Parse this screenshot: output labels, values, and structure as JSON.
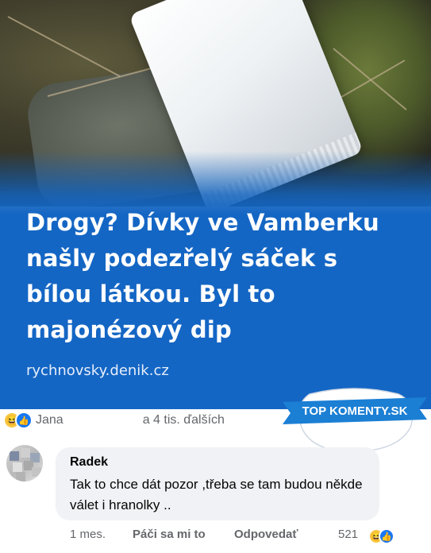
{
  "article": {
    "headline": "Drogy? Dívky ve Vamberku našly podezřelý sáček s bílou látkou. Byl to majonézový dip",
    "source": "rychnovsky.denik.cz"
  },
  "reactions": {
    "icons": [
      "haha-emoji-icon",
      "like-icon"
    ],
    "first_name": "Jana",
    "others": "a 4 tis. ďalších"
  },
  "badge": {
    "text": "TOP KOMENTY.SK",
    "color": "#1b7fd4"
  },
  "comment": {
    "author": "Radek",
    "text": "Tak to chce dát pozor ,třeba se tam budou někde válet i hranolky ..",
    "time": "1 mes.",
    "like_label": "Páči sa mi to",
    "reply_label": "Odpovedať",
    "reaction_count": "521"
  },
  "colors": {
    "headline_band": "#1466c4",
    "like_blue": "#1877f2",
    "bubble_bg": "#f0f2f5",
    "secondary_text": "#65676b"
  }
}
